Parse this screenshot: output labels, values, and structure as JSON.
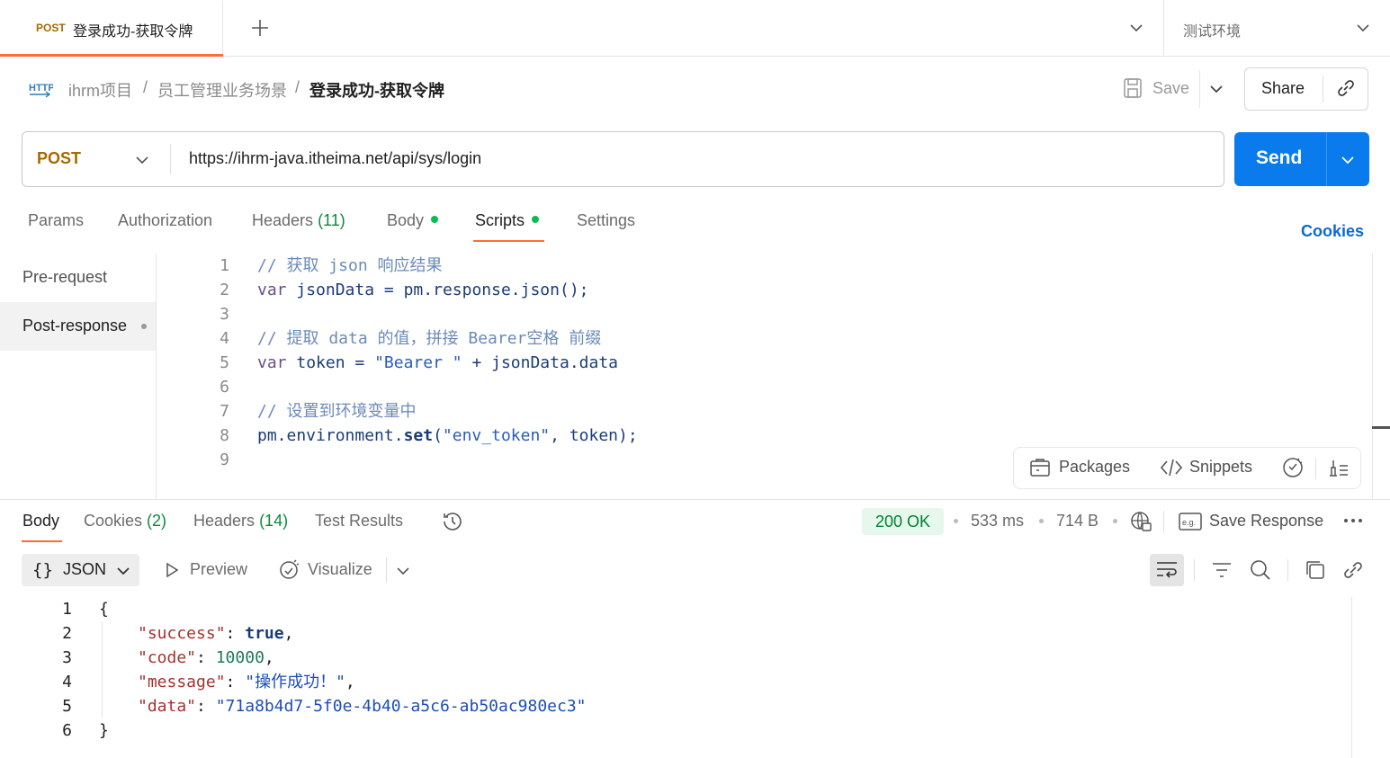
{
  "tab": {
    "method": "POST",
    "title": "登录成功-获取令牌",
    "environment": "测试环境"
  },
  "breadcrumb": {
    "badge": "HTTP",
    "items": [
      "ihrm项目",
      "员工管理业务场景",
      "登录成功-获取令牌"
    ],
    "separator": "/"
  },
  "actions": {
    "save_label": "Save",
    "share_label": "Share"
  },
  "request": {
    "method": "POST",
    "url": "https://ihrm-java.itheima.net/api/sys/login",
    "send_label": "Send"
  },
  "request_tabs": [
    {
      "label": "Params"
    },
    {
      "label": "Authorization"
    },
    {
      "label": "Headers",
      "count": "(11)"
    },
    {
      "label": "Body"
    },
    {
      "label": "Scripts"
    },
    {
      "label": "Settings"
    }
  ],
  "cookies_link": "Cookies",
  "scripts": {
    "sections": [
      "Pre-request",
      "Post-response"
    ],
    "line_numbers": [
      "1",
      "2",
      "3",
      "4",
      "5",
      "6",
      "7",
      "8",
      "9"
    ],
    "code": {
      "l1": "// 获取 json 响应结果",
      "l2_kw": "var",
      "l2_var": "jsonData",
      "l2_eq": " = ",
      "l2_pm": "pm",
      "l2_rest": ".response.json();",
      "l4": "// 提取 data 的值，拼接 Bearer空格 前缀",
      "l5_kw": "var",
      "l5_var": "token",
      "l5_eq": " = ",
      "l5_str": "\"Bearer \"",
      "l5_plus": " + ",
      "l5_rest": "jsonData.data",
      "l7": "// 设置到环境变量中",
      "l8_a": "pm.environment.",
      "l8_fn": "set",
      "l8_b": "(",
      "l8_str": "\"env_token\"",
      "l8_c": ", token);"
    },
    "tools": {
      "packages_label": "Packages",
      "snippets_label": "Snippets"
    }
  },
  "response": {
    "tabs": [
      {
        "label": "Body"
      },
      {
        "label": "Cookies",
        "count": "(2)"
      },
      {
        "label": "Headers",
        "count": "(14)"
      },
      {
        "label": "Test Results"
      }
    ],
    "status": "200 OK",
    "time": "533 ms",
    "size": "714 B",
    "save_response_label": "Save Response",
    "format": "JSON",
    "preview_label": "Preview",
    "visualize_label": "Visualize",
    "line_numbers": [
      "1",
      "2",
      "3",
      "4",
      "5",
      "6"
    ],
    "json": {
      "open": "{",
      "k1": "\"success\"",
      "v1": "true",
      "k2": "\"code\"",
      "v2": "10000",
      "k3": "\"message\"",
      "v3": "\"操作成功！\"",
      "k4": "\"data\"",
      "v4": "\"71a8b4d7-5f0e-4b40-a5c6-ab50ac980ec3\"",
      "close": "}"
    }
  }
}
